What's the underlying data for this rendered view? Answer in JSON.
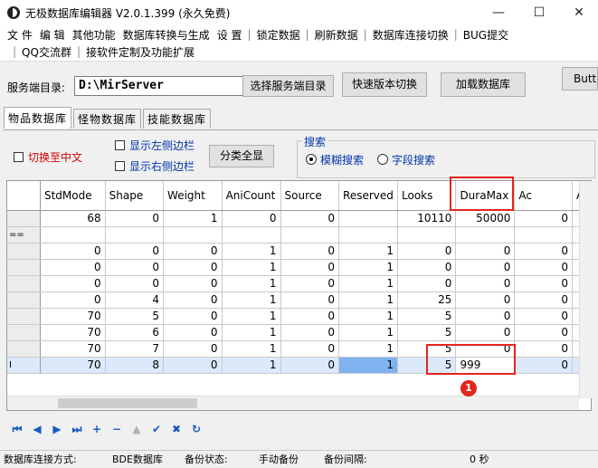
{
  "window": {
    "title": "无极数据库编辑器 V2.0.1.399 (永久免费)",
    "minimize": "—",
    "maximize": "☐",
    "close": "✕"
  },
  "menu": {
    "row1": [
      "文 件",
      "编 辑",
      "其他功能",
      "数据库转换与生成",
      "设 置",
      "锁定数据",
      "刷新数据",
      "数据库连接切换",
      "BUG提交"
    ],
    "row2": [
      "QQ交流群",
      "接软件定制及功能扩展"
    ],
    "separator": "|"
  },
  "toolbar": {
    "server_dir_label": "服务端目录:",
    "server_dir_value": "D:\\MirServer",
    "select_dir_button": "选择服务端目录",
    "quick_switch_button": "快速版本切换",
    "load_db_button": "加载数据库",
    "extra_button": "Button"
  },
  "tabs": [
    "物品数据库",
    "怪物数据库",
    "技能数据库"
  ],
  "filters": {
    "switch_chinese": "切换至中文",
    "show_left_border": "显示左侧边栏",
    "show_right_border": "显示右侧边栏",
    "show_all_categories": "分类全显"
  },
  "search": {
    "title": "搜索",
    "fuzzy": "模糊搜索",
    "field": "字段搜索"
  },
  "grid": {
    "columns": [
      "StdMode",
      "Shape",
      "Weight",
      "AniCount",
      "Source",
      "Reserved",
      "Looks",
      "DuraMax",
      "Ac",
      "A"
    ],
    "rows": [
      {
        "ind": "",
        "cells": [
          "68",
          "0",
          "1",
          "0",
          "0",
          "",
          "10110",
          "50000",
          "0"
        ]
      },
      {
        "ind": "==",
        "cells": [
          "",
          "",
          "",
          "",
          "",
          "",
          "",
          "",
          ""
        ]
      },
      {
        "ind": "",
        "cells": [
          "0",
          "0",
          "0",
          "1",
          "0",
          "1",
          "0",
          "0",
          "0"
        ]
      },
      {
        "ind": "",
        "cells": [
          "0",
          "0",
          "0",
          "1",
          "0",
          "1",
          "0",
          "0",
          "0"
        ]
      },
      {
        "ind": "",
        "cells": [
          "0",
          "0",
          "0",
          "1",
          "0",
          "1",
          "0",
          "0",
          "0"
        ]
      },
      {
        "ind": "",
        "cells": [
          "0",
          "4",
          "0",
          "1",
          "0",
          "1",
          "25",
          "0",
          "0"
        ]
      },
      {
        "ind": "",
        "cells": [
          "70",
          "5",
          "0",
          "1",
          "0",
          "1",
          "5",
          "0",
          "0"
        ]
      },
      {
        "ind": "",
        "cells": [
          "70",
          "6",
          "0",
          "1",
          "0",
          "1",
          "5",
          "0",
          "0"
        ]
      },
      {
        "ind": "",
        "cells": [
          "70",
          "7",
          "0",
          "1",
          "0",
          "1",
          "5",
          "0",
          "0"
        ]
      },
      {
        "ind": "I",
        "cells": [
          "70",
          "8",
          "0",
          "1",
          "0",
          "1",
          "5",
          "999",
          "0"
        ],
        "selected": true
      }
    ]
  },
  "annotation_badge": "1",
  "status": {
    "conn_label": "数据库连接方式:",
    "conn_value": "BDE数据库",
    "backup_label": "备份状态:",
    "backup_value": "手动备份",
    "interval_label": "备份间隔:",
    "interval_value": "0 秒"
  },
  "colors": {
    "highlight_red": "#e2261d",
    "selected_row": "#dbe9fb",
    "current_cell": "#7eb3ef",
    "nav_blue": "#1a5bc4"
  }
}
